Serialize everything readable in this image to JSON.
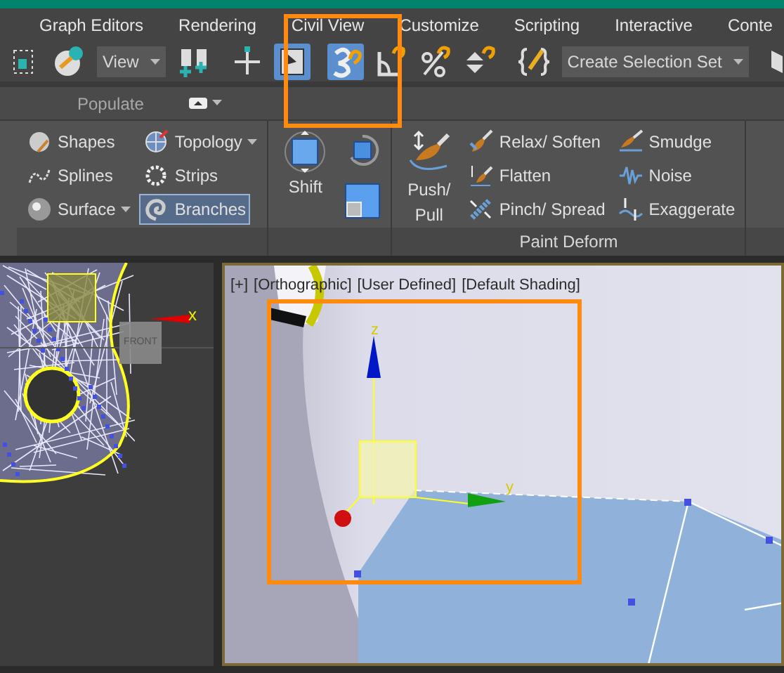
{
  "menu_bar": {
    "items": [
      "Graph Editors",
      "Rendering",
      "Civil View",
      "Customize",
      "Scripting",
      "Interactive",
      "Conte"
    ]
  },
  "main_toolbar": {
    "items": [
      {
        "kind": "button",
        "on": false
      },
      {
        "kind": "button",
        "on": false
      },
      {
        "kind": "dropdown",
        "value": "View"
      },
      {
        "kind": "button",
        "on": false
      },
      {
        "kind": "separator"
      },
      {
        "kind": "button",
        "on": false
      },
      {
        "kind": "button",
        "on": true
      },
      {
        "kind": "separator"
      },
      {
        "kind": "button",
        "on": true
      },
      {
        "kind": "button",
        "on": false
      },
      {
        "kind": "button",
        "on": false
      },
      {
        "kind": "button",
        "on": false
      },
      {
        "kind": "separator"
      },
      {
        "kind": "button",
        "on": false
      },
      {
        "kind": "dropdown",
        "value": "Create Selection Set"
      },
      {
        "kind": "separator"
      },
      {
        "kind": "button",
        "on": false
      }
    ]
  },
  "ribbon_tabs": {
    "label": "Populate",
    "expanded": true
  },
  "ribbon": {
    "panels": [
      {
        "items": [
          {
            "kind": "small",
            "label": "Shapes",
            "dropdown": false,
            "selected": false
          },
          {
            "kind": "small",
            "label": "Splines",
            "dropdown": false,
            "selected": false
          },
          {
            "kind": "small",
            "label": "Surface",
            "dropdown": true,
            "selected": false
          },
          {
            "kind": "small",
            "label": "Topology",
            "dropdown": true,
            "selected": false
          },
          {
            "kind": "small",
            "label": "Strips",
            "dropdown": false,
            "selected": false
          },
          {
            "kind": "small",
            "label": "Branches",
            "dropdown": false,
            "selected": true
          }
        ]
      },
      {
        "items": [
          {
            "kind": "large",
            "label": "Shift"
          },
          {
            "kind": "icon"
          },
          {
            "kind": "icon"
          }
        ]
      },
      {
        "title": "Paint Deform",
        "items": [
          {
            "kind": "large",
            "label": "Push/ Pull"
          },
          {
            "kind": "small",
            "label": "Relax/ Soften",
            "dropdown": false,
            "selected": false
          },
          {
            "kind": "small",
            "label": "Flatten",
            "dropdown": false,
            "selected": false
          },
          {
            "kind": "small",
            "label": "Pinch/ Spread",
            "dropdown": false,
            "selected": false
          },
          {
            "kind": "small",
            "label": "Smudge",
            "dropdown": false,
            "selected": false
          },
          {
            "kind": "small",
            "label": "Noise",
            "dropdown": false,
            "selected": false
          },
          {
            "kind": "small",
            "label": "Exaggerate",
            "dropdown": false,
            "selected": false
          }
        ]
      }
    ]
  },
  "viewports": [
    {
      "kind": "wireframe",
      "axis_label": "x",
      "view_cube": "FRONT"
    },
    {
      "kind": "shaded",
      "labels": [
        "[+]",
        "[Orthographic]",
        "[User Defined]",
        "[Default Shading]"
      ],
      "axis_labels": [
        "z",
        "y"
      ]
    }
  ]
}
